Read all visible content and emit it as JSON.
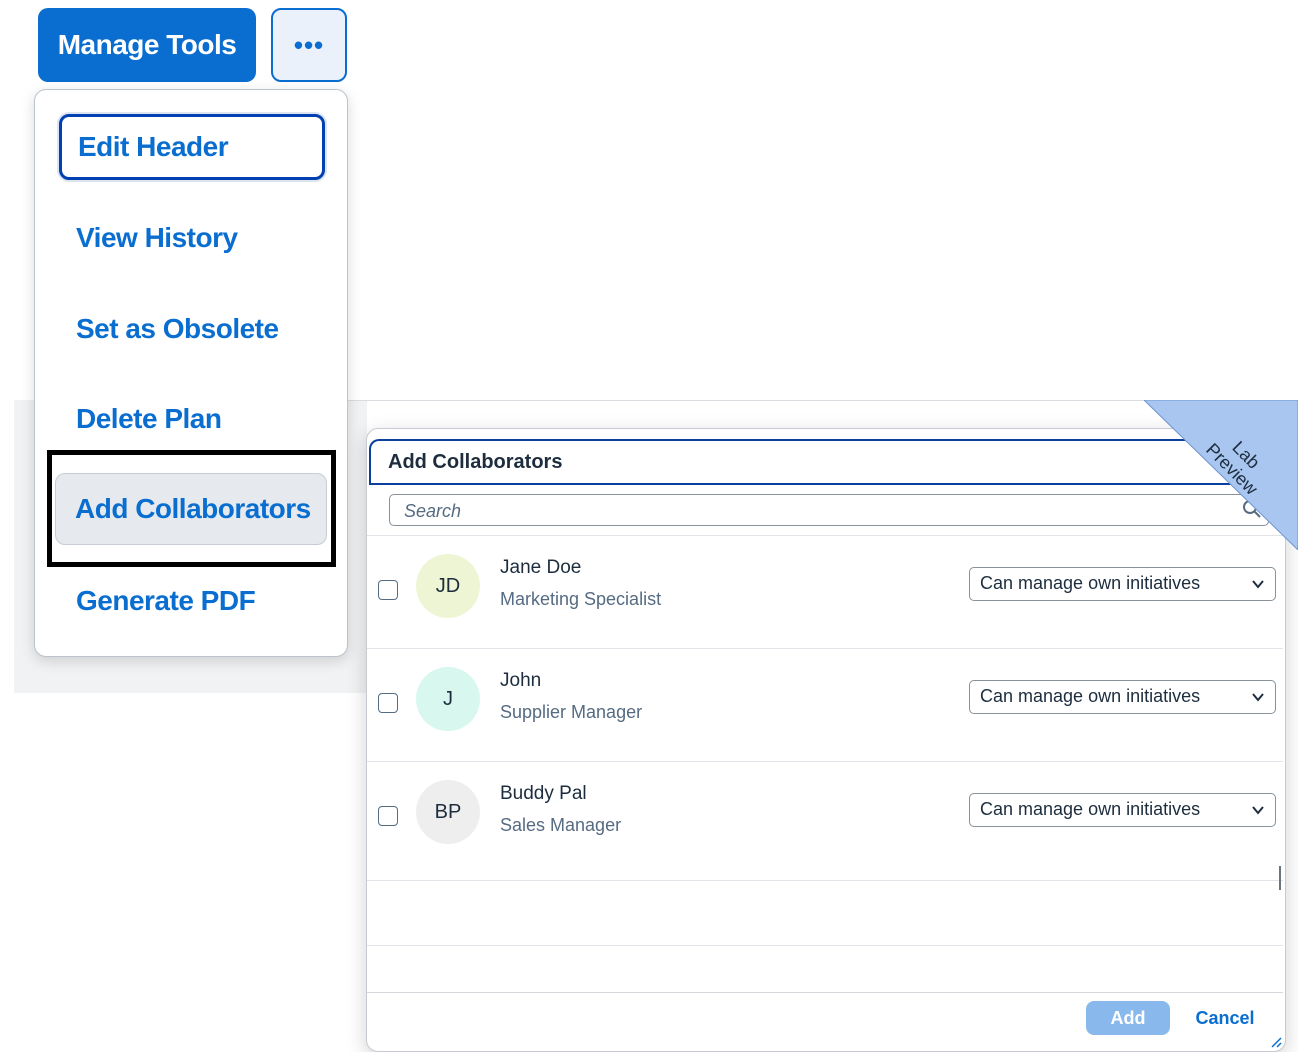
{
  "toolbar": {
    "manage_tools_label": "Manage Tools",
    "more_label": "•••"
  },
  "menu": {
    "items": [
      {
        "label": "Edit Header",
        "state": "focused"
      },
      {
        "label": "View History",
        "state": "normal"
      },
      {
        "label": "Set as Obsolete",
        "state": "normal"
      },
      {
        "label": "Delete Plan",
        "state": "normal"
      },
      {
        "label": "Add Collaborators",
        "state": "hovered"
      },
      {
        "label": "Generate PDF",
        "state": "normal"
      }
    ]
  },
  "dialog": {
    "title": "Add Collaborators",
    "search_placeholder": "Search",
    "people": [
      {
        "initials": "JD",
        "name": "Jane Doe",
        "role": "Marketing Specialist",
        "permission": "Can manage own initiatives",
        "checked": false,
        "avatar_color": "#eef5d4"
      },
      {
        "initials": "J",
        "name": "John",
        "role": "Supplier Manager",
        "permission": "Can manage own initiatives",
        "checked": false,
        "avatar_color": "#d7f7ef"
      },
      {
        "initials": "BP",
        "name": "Buddy Pal",
        "role": "Sales Manager",
        "permission": "Can manage own initiatives",
        "checked": false,
        "avatar_color": "#eeeeee"
      }
    ],
    "add_label": "Add",
    "cancel_label": "Cancel"
  },
  "ribbon": {
    "line1": "Lab",
    "line2": "Preview"
  },
  "colors": {
    "brand_blue": "#0a6ed1",
    "ribbon_blue": "#a8c6f0"
  }
}
